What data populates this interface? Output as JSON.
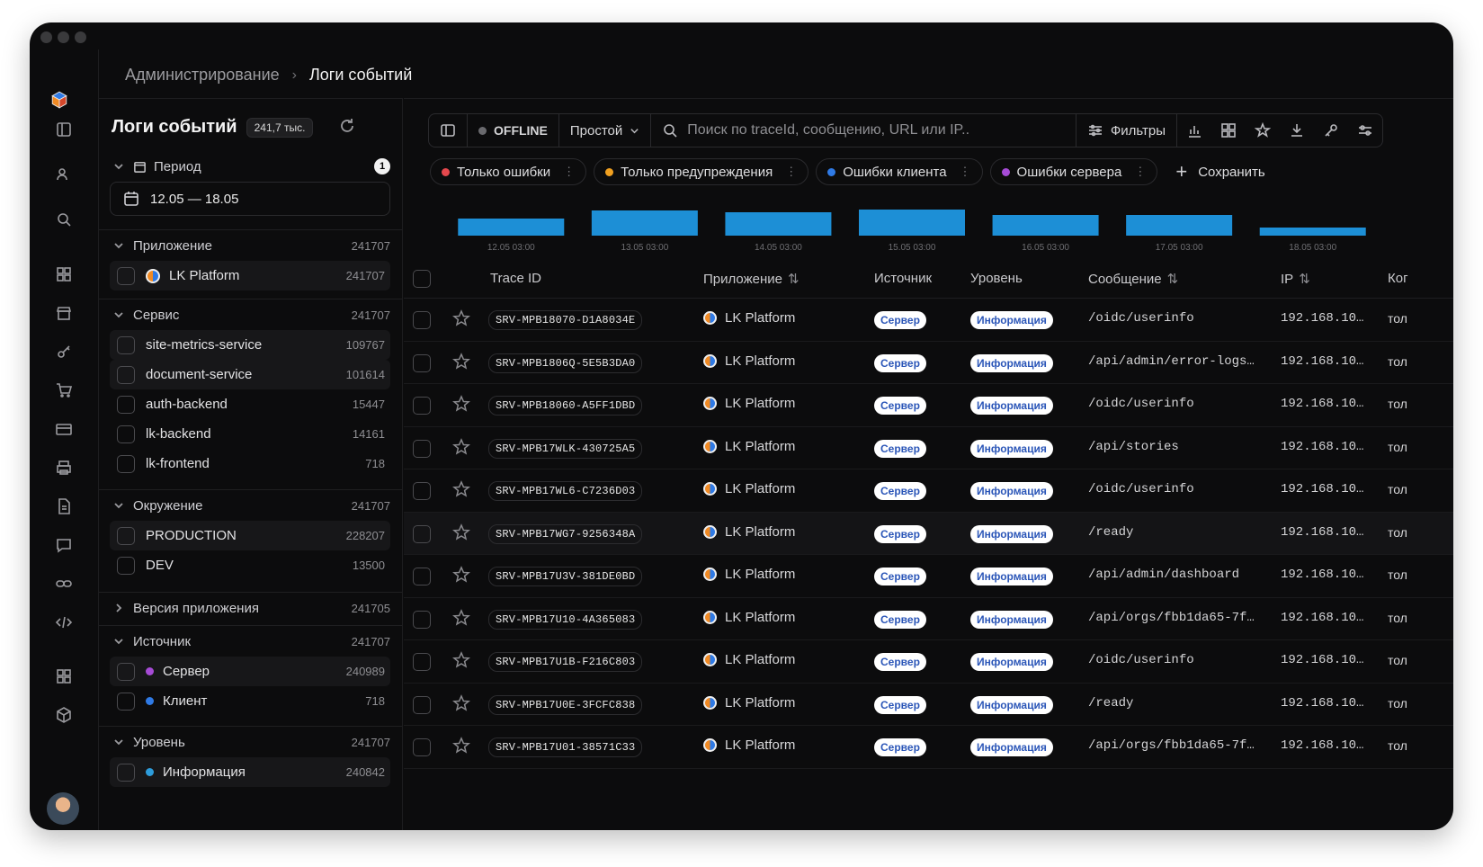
{
  "breadcrumb": {
    "parent": "Администрирование",
    "separator": "›",
    "current": "Логи событий"
  },
  "sidebar": {
    "title": "Логи событий",
    "total_badge": "241,7 тыс.",
    "period": {
      "label": "Период",
      "pill": "1",
      "range": "12.05 — 18.05"
    },
    "sections": {
      "app": {
        "label": "Приложение",
        "count": "241707",
        "items": [
          {
            "label": "LK Platform",
            "count": "241707"
          }
        ]
      },
      "service": {
        "label": "Сервис",
        "count": "241707",
        "items": [
          {
            "label": "site-metrics-service",
            "count": "109767"
          },
          {
            "label": "document-service",
            "count": "101614"
          },
          {
            "label": "auth-backend",
            "count": "15447"
          },
          {
            "label": "lk-backend",
            "count": "14161"
          },
          {
            "label": "lk-frontend",
            "count": "718"
          }
        ]
      },
      "env": {
        "label": "Окружение",
        "count": "241707",
        "items": [
          {
            "label": "PRODUCTION",
            "count": "228207"
          },
          {
            "label": "DEV",
            "count": "13500"
          }
        ]
      },
      "version": {
        "label": "Версия приложения",
        "count": "241705"
      },
      "source": {
        "label": "Источник",
        "count": "241707",
        "items": [
          {
            "label": "Сервер",
            "count": "240989",
            "color": "#a64bd6"
          },
          {
            "label": "Клиент",
            "count": "718",
            "color": "#2f7ae5"
          }
        ]
      },
      "level": {
        "label": "Уровень",
        "count": "241707",
        "items": [
          {
            "label": "Информация",
            "count": "240842",
            "color": "#2d9cdb"
          }
        ]
      }
    }
  },
  "toolbar": {
    "status": "OFFLINE",
    "mode": "Простой",
    "search_placeholder": "Поиск по traceId, сообщению, URL или IP..",
    "filters": "Фильтры"
  },
  "chips": [
    {
      "label": "Только ошибки",
      "color": "#e5484d"
    },
    {
      "label": "Только предупреждения",
      "color": "#f0a020"
    },
    {
      "label": "Ошибки клиента",
      "color": "#2f7ae5"
    },
    {
      "label": "Ошибки сервера",
      "color": "#a64bd6"
    }
  ],
  "save_label": "Сохранить",
  "chart_data": {
    "type": "bar",
    "categories": [
      "12.05 03:00",
      "13.05 03:00",
      "14.05 03:00",
      "15.05 03:00",
      "16.05 03:00",
      "17.05 03:00",
      "18.05 03:00"
    ],
    "values": [
      19,
      28,
      26,
      29,
      23,
      23,
      9
    ],
    "color": "#1d8fd6"
  },
  "table": {
    "headers": {
      "trace": "Trace ID",
      "app": "Приложение",
      "source": "Источник",
      "level": "Уровень",
      "message": "Сообщение",
      "ip": "IP",
      "last": "Ког"
    },
    "rows": [
      {
        "trace": "SRV-MPB18070-D1A8034E",
        "app": "LK Platform",
        "source": "Сервер",
        "level": "Информация",
        "message": "/oidc/userinfo",
        "ip": "192.168.10…",
        "last": "тол"
      },
      {
        "trace": "SRV-MPB1806Q-5E5B3DA0",
        "app": "LK Platform",
        "source": "Сервер",
        "level": "Информация",
        "message": "/api/admin/error-logs…",
        "ip": "192.168.10…",
        "last": "тол"
      },
      {
        "trace": "SRV-MPB18060-A5FF1DBD",
        "app": "LK Platform",
        "source": "Сервер",
        "level": "Информация",
        "message": "/oidc/userinfo",
        "ip": "192.168.10…",
        "last": "тол"
      },
      {
        "trace": "SRV-MPB17WLK-430725A5",
        "app": "LK Platform",
        "source": "Сервер",
        "level": "Информация",
        "message": "/api/stories",
        "ip": "192.168.10…",
        "last": "тол"
      },
      {
        "trace": "SRV-MPB17WL6-C7236D03",
        "app": "LK Platform",
        "source": "Сервер",
        "level": "Информация",
        "message": "/oidc/userinfo",
        "ip": "192.168.10…",
        "last": "тол"
      },
      {
        "trace": "SRV-MPB17WG7-9256348A",
        "app": "LK Platform",
        "source": "Сервер",
        "level": "Информация",
        "message": "/ready",
        "ip": "192.168.10…",
        "last": "тол"
      },
      {
        "trace": "SRV-MPB17U3V-381DE0BD",
        "app": "LK Platform",
        "source": "Сервер",
        "level": "Информация",
        "message": "/api/admin/dashboard",
        "ip": "192.168.10…",
        "last": "тол"
      },
      {
        "trace": "SRV-MPB17U10-4A365083",
        "app": "LK Platform",
        "source": "Сервер",
        "level": "Информация",
        "message": "/api/orgs/fbb1da65-7f…",
        "ip": "192.168.10…",
        "last": "тол"
      },
      {
        "trace": "SRV-MPB17U1B-F216C803",
        "app": "LK Platform",
        "source": "Сервер",
        "level": "Информация",
        "message": "/oidc/userinfo",
        "ip": "192.168.10…",
        "last": "тол"
      },
      {
        "trace": "SRV-MPB17U0E-3FCFC838",
        "app": "LK Platform",
        "source": "Сервер",
        "level": "Информация",
        "message": "/ready",
        "ip": "192.168.10…",
        "last": "тол"
      },
      {
        "trace": "SRV-MPB17U01-38571C33",
        "app": "LK Platform",
        "source": "Сервер",
        "level": "Информация",
        "message": "/api/orgs/fbb1da65-7f…",
        "ip": "192.168.10…",
        "last": "тол"
      }
    ]
  }
}
